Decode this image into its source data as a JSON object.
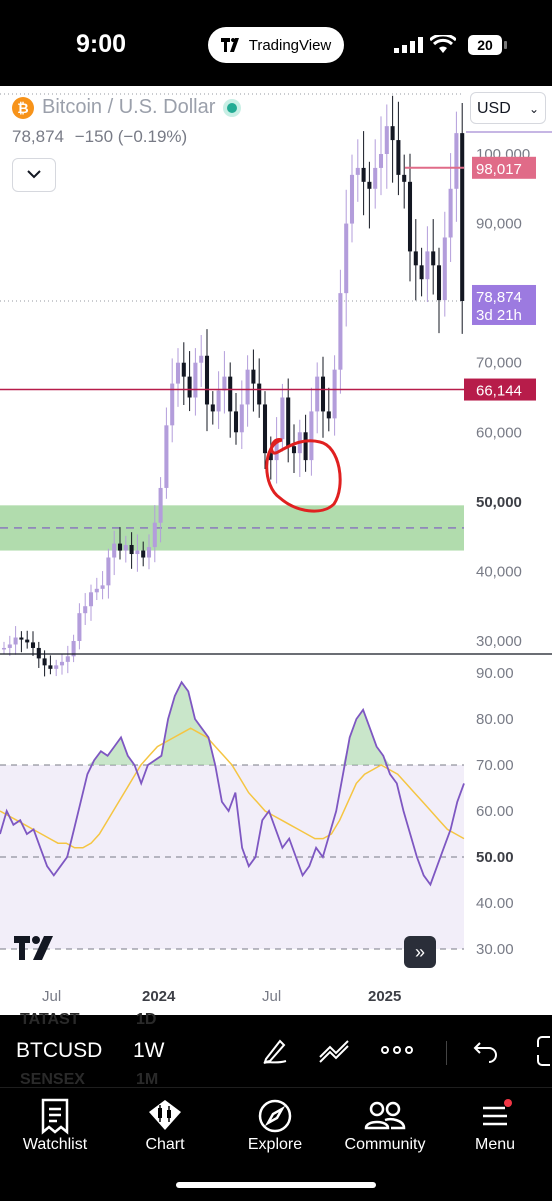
{
  "status_bar": {
    "time": "9:00",
    "pill_label": "TradingView",
    "battery": "20"
  },
  "header": {
    "symbol_title": "Bitcoin / U.S. Dollar",
    "last_price": "78,874",
    "change": "−150 (−0.19%)",
    "currency": "USD"
  },
  "price_axis": {
    "ticks": [
      "100,000",
      "90,000",
      "80,000",
      "70,000",
      "60,000",
      "50,000",
      "40,000",
      "30,000"
    ]
  },
  "price_labels": {
    "line_upper": "98,017",
    "current_price": "78,874",
    "countdown": "3d 21h",
    "line_lower": "66,144"
  },
  "rsi_axis": {
    "ticks": [
      "90.00",
      "80.00",
      "70.00",
      "60.00",
      "50.00",
      "40.00",
      "30.00"
    ]
  },
  "time_axis": {
    "ticks": [
      "Jul",
      "2024",
      "Jul",
      "2025"
    ]
  },
  "toolbar": {
    "symbol": "BTCUSD",
    "timeframe": "1W",
    "ghost_symbols": [
      "TATAST",
      "SENSEX"
    ],
    "ghost_timeframes": [
      "1D",
      "1M"
    ]
  },
  "nav": {
    "items": [
      "Watchlist",
      "Chart",
      "Explore",
      "Community",
      "Menu"
    ]
  },
  "colors": {
    "accent_purple": "#b39ddb",
    "line_red": "#b71c4a",
    "line_pink": "#e06b88",
    "zone_green": "#a8d8a4",
    "rsi_line": "#7e57c2",
    "rsi_ma": "#f5c542",
    "annotation": "#e02020"
  },
  "chart_data": {
    "type": "candlestick",
    "symbol": "BTCUSD",
    "interval": "1W",
    "x_ticks": [
      "Jul",
      "2024",
      "Jul",
      "2025"
    ],
    "y_range": [
      28000,
      108000
    ],
    "approx_weekly_close": [
      29000,
      29500,
      30500,
      30200,
      29800,
      29000,
      27500,
      26500,
      26000,
      26500,
      27000,
      27800,
      30000,
      34000,
      35000,
      37000,
      37500,
      38000,
      42000,
      44000,
      43000,
      43800,
      42500,
      43000,
      42000,
      43500,
      47000,
      52000,
      61000,
      67000,
      70000,
      68000,
      65000,
      70000,
      71000,
      64000,
      63000,
      66000,
      68000,
      63000,
      60000,
      64000,
      69000,
      67000,
      64000,
      57000,
      56000,
      59000,
      65000,
      58000,
      57000,
      60000,
      56000,
      63000,
      68000,
      63000,
      62000,
      69000,
      80000,
      90000,
      97000,
      98000,
      96000,
      95000,
      98000,
      100000,
      104000,
      102000,
      97000,
      96000,
      86000,
      84000,
      82000,
      86000,
      84000,
      79000,
      88000,
      95000,
      103000,
      78874
    ],
    "horizontal_lines": [
      98017,
      66144
    ],
    "support_zone": [
      43000,
      49500
    ],
    "current_price": 78874,
    "rsi": {
      "range": [
        30,
        90
      ],
      "levels": [
        70,
        50,
        30
      ],
      "approx_values": [
        55,
        60,
        57,
        58,
        55,
        56,
        52,
        48,
        46,
        48,
        50,
        56,
        62,
        68,
        71,
        73,
        72,
        74,
        76,
        72,
        70,
        66,
        70,
        71,
        72,
        80,
        85,
        88,
        86,
        80,
        78,
        76,
        70,
        62,
        60,
        64,
        52,
        48,
        50,
        58,
        60,
        56,
        52,
        54,
        50,
        46,
        48,
        52,
        50,
        55,
        60,
        68,
        76,
        80,
        82,
        78,
        74,
        72,
        68,
        66,
        60,
        55,
        50,
        46,
        44,
        48,
        52,
        56,
        62,
        66
      ],
      "approx_ma": [
        60,
        59,
        58,
        57,
        56,
        55,
        54,
        53,
        53,
        52,
        52,
        53,
        55,
        58,
        61,
        64,
        67,
        70,
        72,
        74,
        75,
        76,
        77,
        78,
        77,
        76,
        74,
        72,
        70,
        67,
        64,
        62,
        60,
        59,
        58,
        57,
        56,
        55,
        54,
        54,
        55,
        58,
        62,
        66,
        68,
        69,
        70,
        69,
        68,
        66,
        64,
        62,
        60,
        58,
        56,
        55,
        54
      ]
    }
  }
}
